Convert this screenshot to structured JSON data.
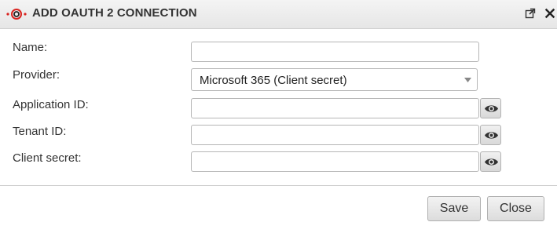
{
  "dialog": {
    "title": "ADD OAUTH 2 CONNECTION",
    "logo_icon": "securepoint-logo-icon",
    "titlebar_icons": [
      "popout-icon",
      "close-icon"
    ]
  },
  "form": {
    "name_label": "Name:",
    "name_value": "",
    "provider_label": "Provider:",
    "provider_value": "Microsoft 365 (Client secret)",
    "application_id_label": "Application ID:",
    "application_id_value": "",
    "tenant_id_label": "Tenant ID:",
    "tenant_id_value": "",
    "client_secret_label": "Client secret:",
    "client_secret_value": ""
  },
  "buttons": {
    "save": "Save",
    "close": "Close"
  },
  "colors": {
    "logo_red": "#d9231f",
    "text": "#333333",
    "border": "#b5b5b5"
  }
}
